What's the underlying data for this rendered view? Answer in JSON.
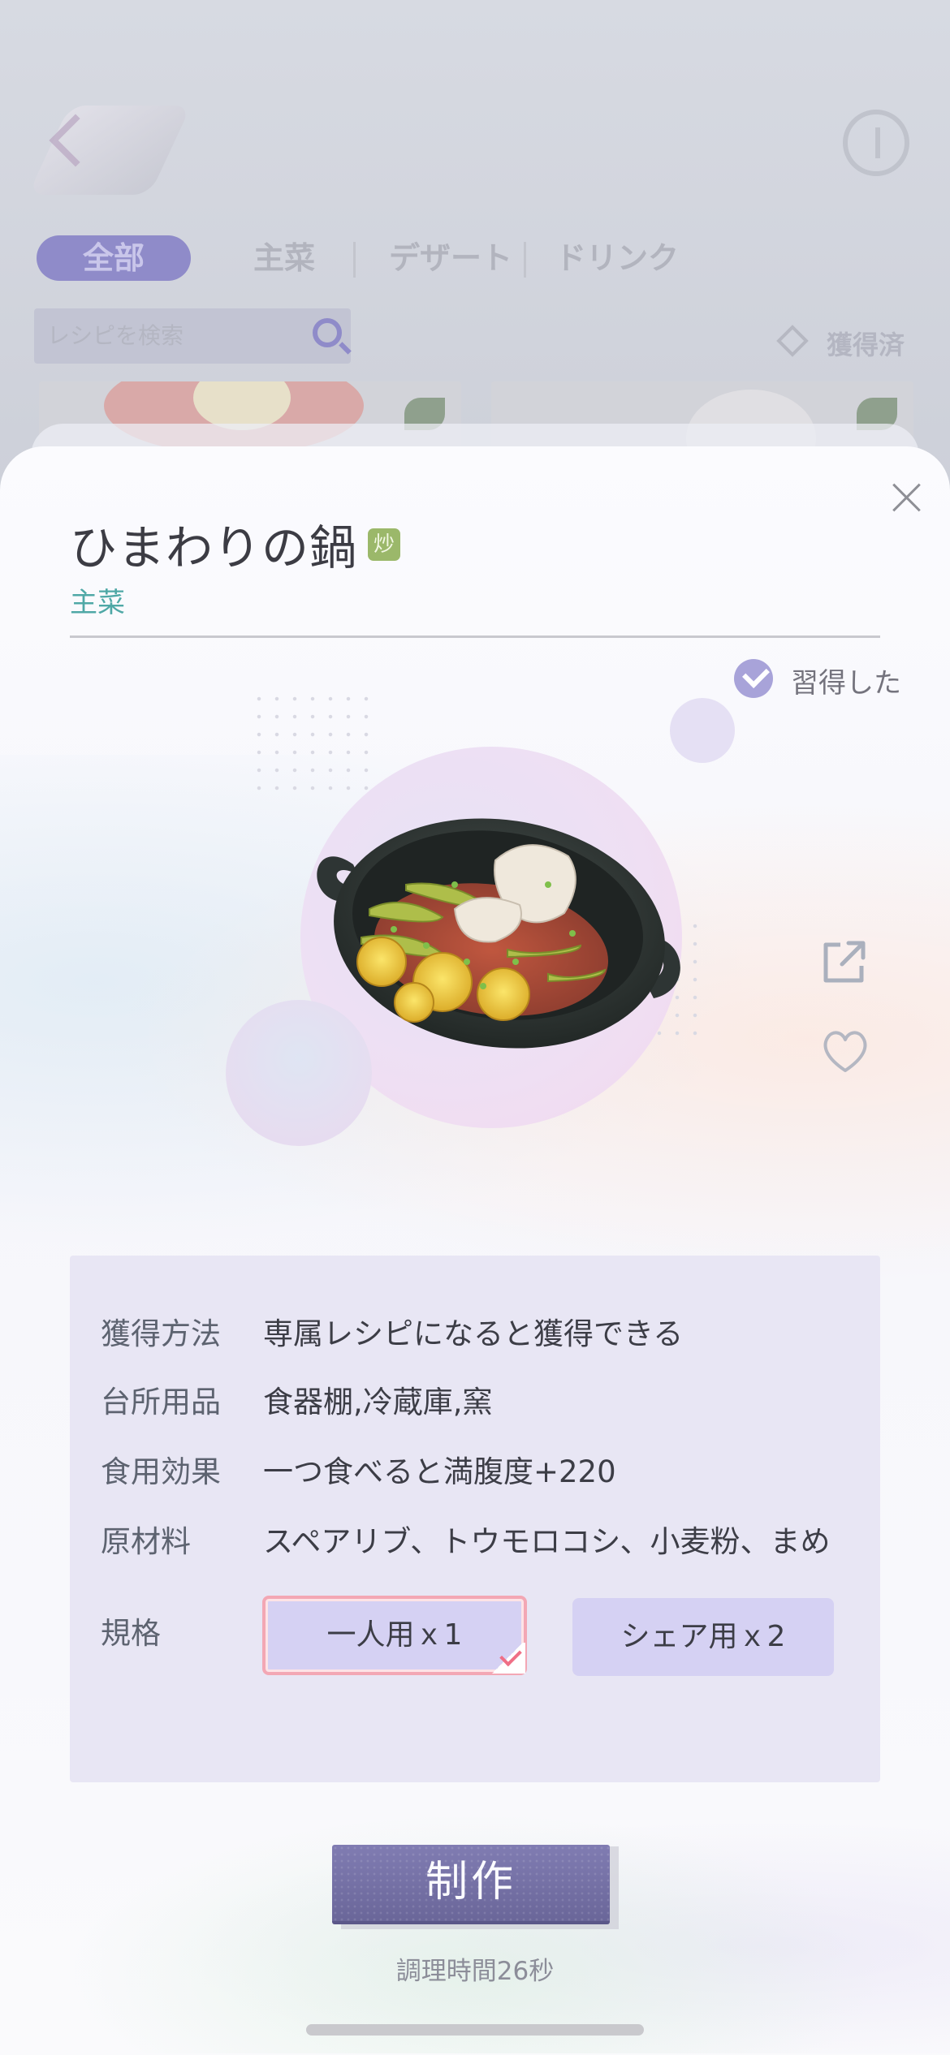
{
  "background": {
    "tabs": [
      "全部",
      "主菜",
      "デザート",
      "ドリンク"
    ],
    "search_placeholder": "レシピを検索",
    "filter_label": "獲得済"
  },
  "recipe": {
    "title": "ひまわりの鍋",
    "method_badge": "炒",
    "category": "主菜",
    "learned_label": "習得した"
  },
  "info": {
    "rows": [
      {
        "label": "獲得方法",
        "value": "専属レシピになると獲得できる"
      },
      {
        "label": "台所用品",
        "value": "食器棚,冷蔵庫,窯"
      },
      {
        "label": "食用効果",
        "value": "一つ食べると満腹度+220"
      },
      {
        "label": "原材料",
        "value": "スペアリブ、トウモロコシ、小麦粉、まめ"
      }
    ],
    "spec_label": "規格",
    "spec_options": [
      {
        "label": "一人用ｘ1",
        "selected": true
      },
      {
        "label": "シェア用ｘ2",
        "selected": false
      }
    ]
  },
  "actions": {
    "make_label": "制作",
    "cook_time": "調理時間26秒"
  },
  "colors": {
    "accent": "#8f8bc9",
    "category_text": "#4fa8a6",
    "make_button": "#77739f",
    "selected_border": "#f3a7b4"
  },
  "icons": [
    "close-icon",
    "check-circle-icon",
    "share-icon",
    "heart-icon",
    "search-icon",
    "back-icon",
    "info-icon"
  ]
}
